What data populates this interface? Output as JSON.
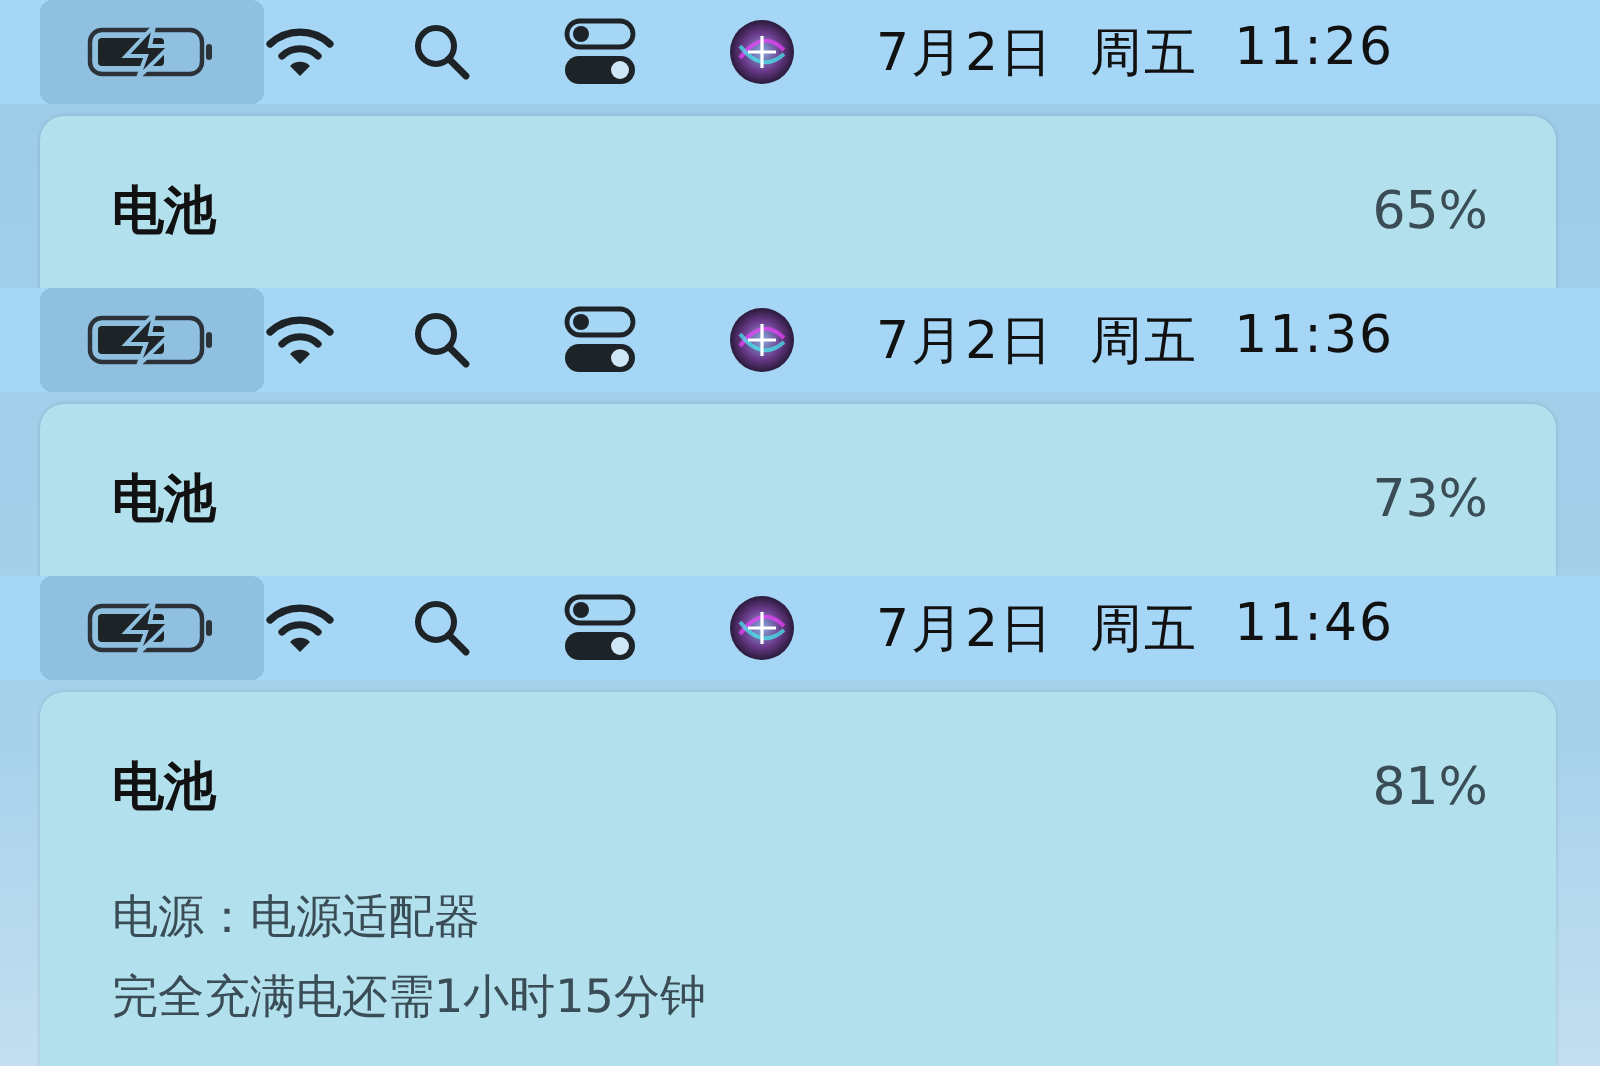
{
  "snapshots": [
    {
      "menu_bar": {
        "date": "7月2日",
        "weekday": "周五",
        "time": "11:26"
      },
      "panel": {
        "title": "电池",
        "percent": "65%"
      }
    },
    {
      "menu_bar": {
        "date": "7月2日",
        "weekday": "周五",
        "time": "11:36"
      },
      "panel": {
        "title": "电池",
        "percent": "73%"
      }
    },
    {
      "menu_bar": {
        "date": "7月2日",
        "weekday": "周五",
        "time": "11:46"
      },
      "panel": {
        "title": "电池",
        "percent": "81%",
        "details": [
          "电源：电源适配器",
          "完全充满电还需1小时15分钟"
        ]
      }
    }
  ]
}
